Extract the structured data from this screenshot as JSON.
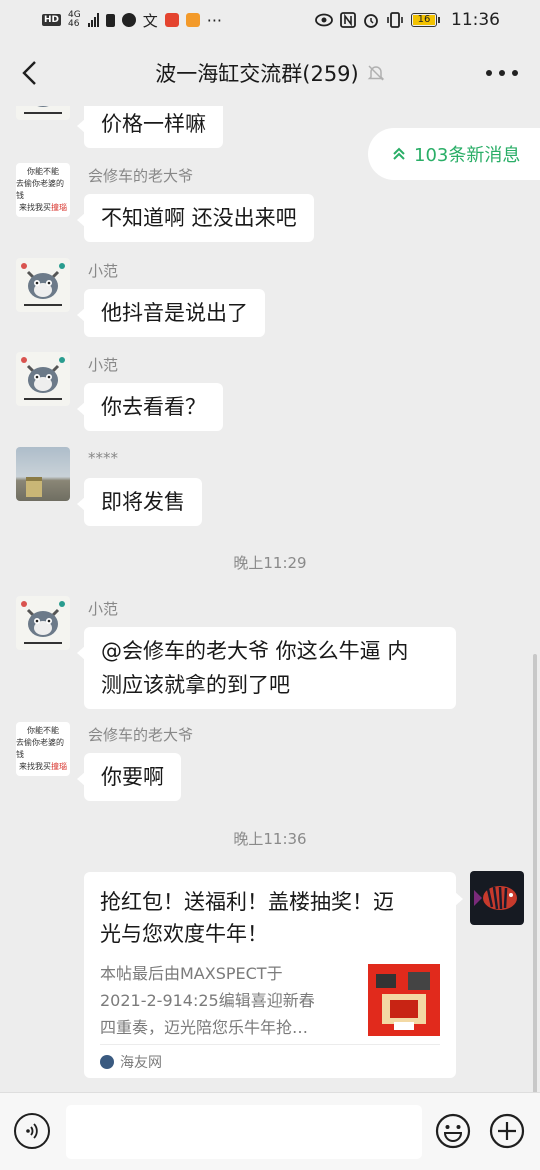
{
  "status_bar": {
    "hd": "HD",
    "net_top": "4G",
    "net_bottom": "46",
    "more": "···",
    "battery": "16",
    "time": "11:36",
    "icons": [
      "signal-icon",
      "sim-icon",
      "app-icon",
      "text-app-icon",
      "video-app-icon",
      "heart-app-icon",
      "eye-icon",
      "nfc-icon",
      "alarm-icon",
      "vibrate-icon",
      "battery-icon"
    ]
  },
  "header": {
    "title": "波一海缸交流群(259)",
    "icons": [
      "back-icon",
      "mute-bell-icon",
      "more-icon"
    ]
  },
  "new_messages": {
    "label": "103条新消息",
    "icon": "double-chevron-up-icon",
    "color": "#2aae67"
  },
  "messages": [
    {
      "sender": "",
      "text": "价格一样嘛",
      "avatar": "tom-cat-avatar"
    },
    {
      "sender": "会修车的老大爷",
      "text": "不知道啊 还没出来吧",
      "avatar": "text-avatar"
    },
    {
      "sender": "小范",
      "text": "他抖音是说出了",
      "avatar": "tom-cat-avatar"
    },
    {
      "sender": "小范",
      "text": "你去看看？",
      "avatar": "tom-cat-avatar"
    },
    {
      "sender": "****",
      "text": "即将发售",
      "avatar": "photo-avatar"
    },
    {
      "sender": "小范",
      "text_line1": "@会修车的老大爷  你这么牛逼 内",
      "text_line2": "测应该就拿的到了吧",
      "avatar": "tom-cat-avatar"
    },
    {
      "sender": "会修车的老大爷",
      "text": "你要啊",
      "avatar": "text-avatar"
    }
  ],
  "timestamps": [
    "晚上11:29",
    "晚上11:36"
  ],
  "avatar_text": {
    "line1": "你能不能",
    "line2": "去偷你老婆的钱",
    "line3_a": "来找我买",
    "line3_b": "撞瑙"
  },
  "share_card": {
    "title_line1": "抢红包！送福利！盖楼抽奖！迈",
    "title_line2": "光与您欢度牛年！",
    "desc_line1": "本帖最后由MAXSPECT于",
    "desc_line2": "2021-2-914:25编辑喜迎新春",
    "desc_line3": "四重奏，迈光陪您乐牛年抢…",
    "source": "海友网"
  },
  "input_bar": {
    "placeholder": "",
    "icons": [
      "voice-icon",
      "emoji-icon",
      "plus-icon"
    ]
  },
  "colors": {
    "background": "#ededed",
    "bubble": "#ffffff",
    "accent_green": "#2aae67"
  }
}
